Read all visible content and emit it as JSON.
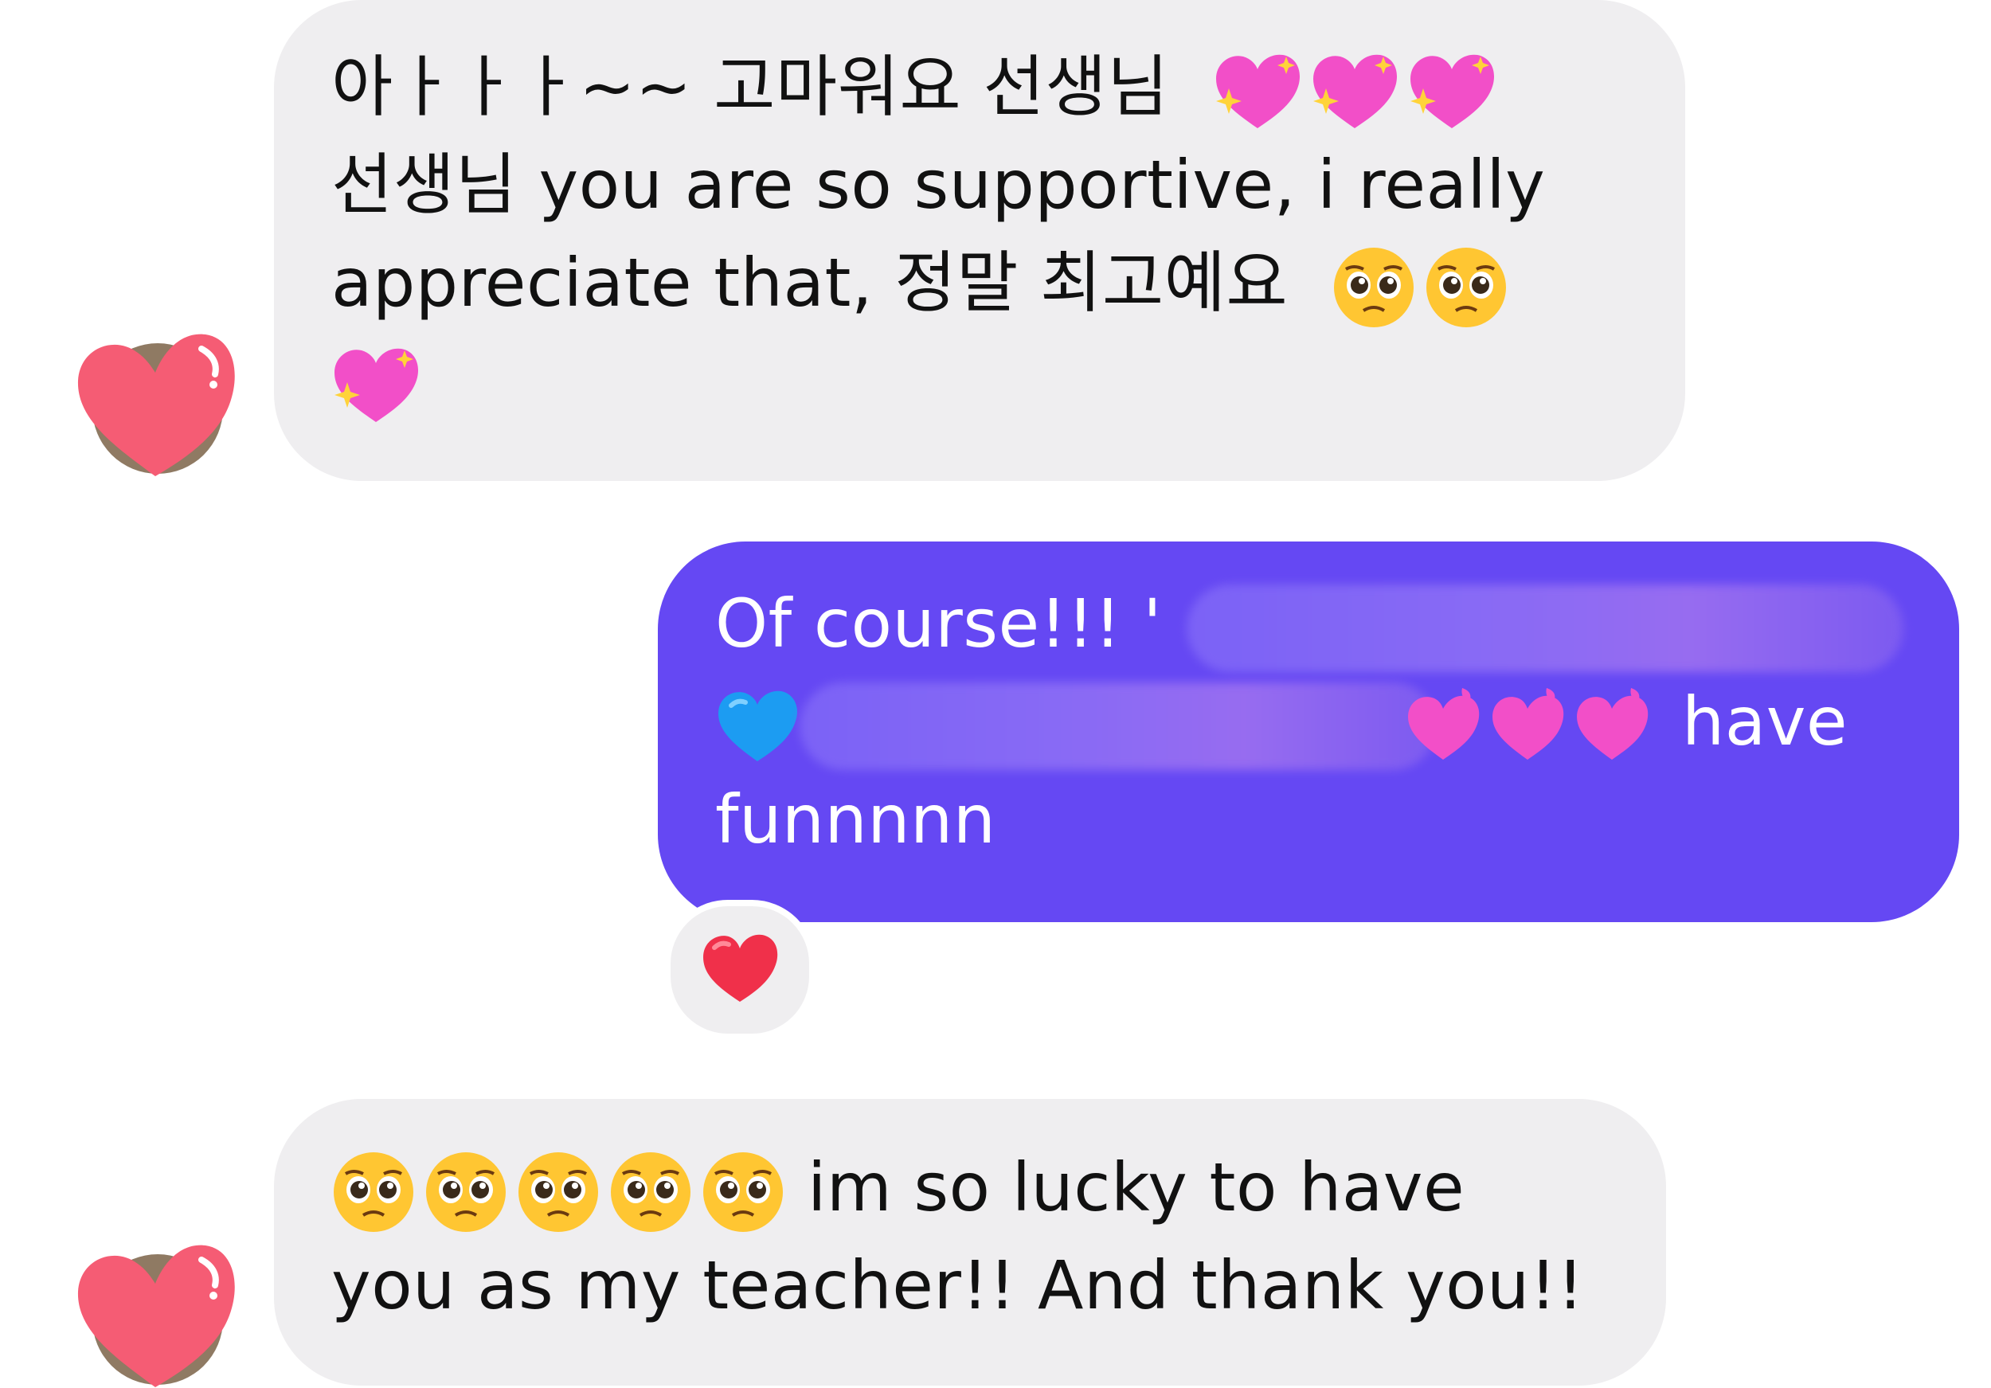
{
  "messages": [
    {
      "sender": "them",
      "lines": [
        {
          "text": "아ㅏㅏㅏ~~ 고마워요 선생님",
          "emojis": [
            "sparkling-heart",
            "sparkling-heart",
            "sparkling-heart"
          ]
        },
        {
          "text": "선생님 you are so supportive, i really"
        },
        {
          "text": "appreciate that, 정말 최고예요",
          "emojis": [
            "pleading-face",
            "pleading-face"
          ]
        },
        {
          "text": "",
          "emojis": [
            "sparkling-heart"
          ]
        }
      ]
    },
    {
      "sender": "me",
      "lines": [
        {
          "text": "Of course!!! '",
          "redacted": true
        },
        {
          "text": "have",
          "prefix_emojis": [
            "blue-heart"
          ],
          "redacted": true,
          "emojis_before_text": [
            "pink-heart",
            "pink-heart",
            "pink-heart"
          ]
        },
        {
          "text": "funnnnn"
        }
      ],
      "reaction": "red-heart"
    },
    {
      "sender": "them",
      "lines": [
        {
          "text": "im so lucky to have",
          "prefix_emojis": [
            "pleading-face",
            "pleading-face",
            "pleading-face",
            "pleading-face",
            "pleading-face"
          ]
        },
        {
          "text": "you as my teacher!! And thank you!!"
        }
      ]
    }
  ],
  "colors": {
    "incoming_bubble": "#efeef0",
    "outgoing_bubble": "#6548f3",
    "avatar_heart": "#f55c74",
    "reaction_heart": "#f0304a"
  }
}
